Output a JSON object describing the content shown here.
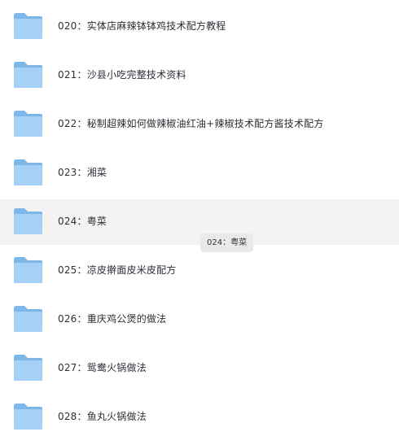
{
  "folders": [
    {
      "label": "020：实体店麻辣钵钵鸡技术配方教程",
      "icon": "folder-icon"
    },
    {
      "label": "021：沙县小吃完整技术资料",
      "icon": "folder-icon"
    },
    {
      "label": "022：秘制超辣如何做辣椒油红油+辣椒技术配方酱技术配方",
      "icon": "folder-icon"
    },
    {
      "label": "023：湘菜",
      "icon": "folder-icon"
    },
    {
      "label": "024：粤菜",
      "icon": "folder-icon",
      "hovered": true
    },
    {
      "label": "025：凉皮擀面皮米皮配方",
      "icon": "folder-icon"
    },
    {
      "label": "026：重庆鸡公煲的做法",
      "icon": "folder-icon"
    },
    {
      "label": "027：鸳鸯火锅做法",
      "icon": "folder-icon"
    },
    {
      "label": "028：鱼丸火锅做法",
      "icon": "folder-icon"
    }
  ],
  "tooltip": {
    "text": "024：粤菜"
  },
  "colors": {
    "hover_background": "#f3f3f4",
    "folder_back": "#7db7ea",
    "folder_front": "#a6d0f5",
    "tooltip_background": "#e9e9ea",
    "text": "#2b2f36"
  }
}
